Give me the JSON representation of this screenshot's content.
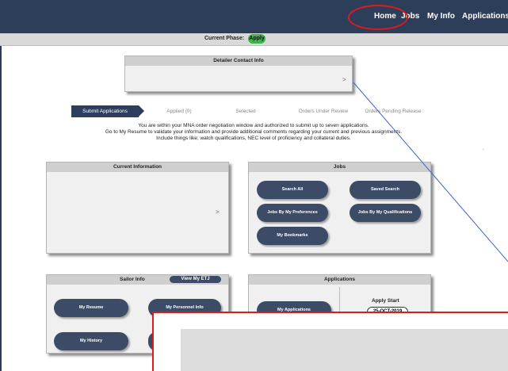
{
  "nav": {
    "items": [
      "Home",
      "Jobs",
      "My Info",
      "Applications"
    ]
  },
  "phase": {
    "label": "Current Phase:",
    "value": "Apply"
  },
  "detailer": {
    "title": "Detailer Contact Info",
    "chevron": ">"
  },
  "steps": [
    "Submit Applications",
    "Applied (0)",
    "Selected",
    "Orders Under Review",
    "Orders Pending Release"
  ],
  "intro": {
    "line1": "You are within your MNA order negotiation window and authorized to submit up to seven applications.",
    "line2": "Go to My Resume to validate your information and provide additional comments regarding your current and previous assignments.",
    "line3": "Include things like; watch qualifications, NEC level of proficiency and collateral duties."
  },
  "current_info": {
    "title": "Current Information",
    "chevron": ">"
  },
  "jobs": {
    "title": "Jobs",
    "buttons": [
      "Search All",
      "Saved Search",
      "Jobs By My Preferences",
      "Jobs By My Qualifications",
      "My Bookmarks"
    ]
  },
  "sailor": {
    "title": "Sailor Info",
    "etj_label": "View My ETJ",
    "buttons": [
      "My Resume",
      "My Personnel Info",
      "My History"
    ]
  },
  "applications": {
    "title": "Applications",
    "button": "My Applications",
    "apply_start_label": "Apply Start",
    "apply_start_date": "25-OCT-2019"
  },
  "misc": {
    "dot": "."
  },
  "colors": {
    "nav_bg": "#2d3e5b",
    "button_bg": "#3c4b66",
    "phase_green": "#3bb54a",
    "annotation_red": "#e01a1a"
  }
}
